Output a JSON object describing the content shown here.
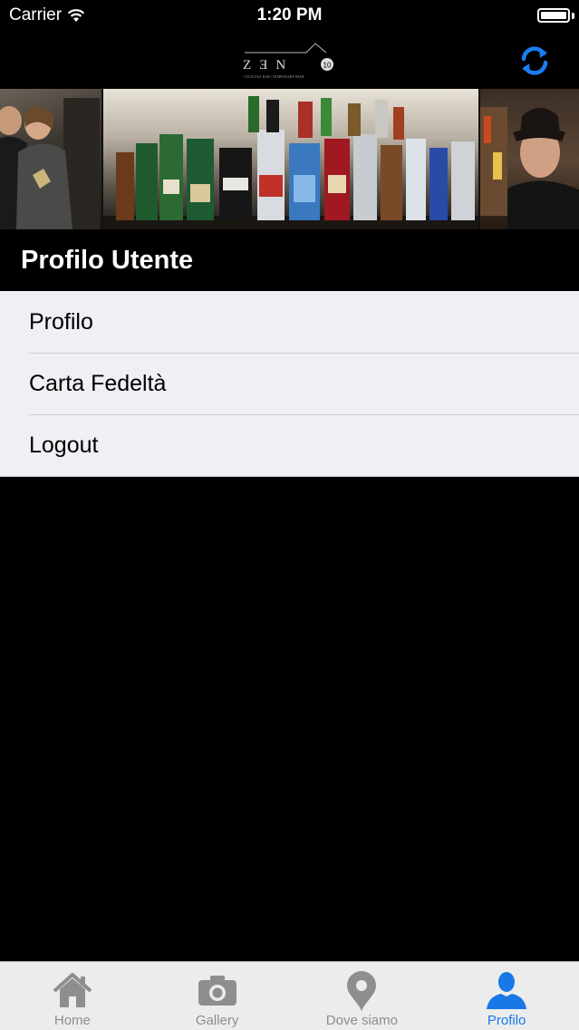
{
  "status_bar": {
    "carrier": "Carrier",
    "time": "1:20 PM"
  },
  "nav": {
    "logo_text": "Z Ǝ N",
    "logo_subtitle": "COCKTAIL BAR | TEMPORARY BIAR",
    "refresh_icon": "refresh-icon",
    "accent": "#1a7ef0"
  },
  "banner": {
    "images": [
      "people-photo",
      "bar-bottles-photo",
      "bartender-photo"
    ]
  },
  "section": {
    "title": "Profilo Utente"
  },
  "menu": {
    "items": [
      {
        "label": "Profilo"
      },
      {
        "label": "Carta Fedeltà"
      },
      {
        "label": "Logout"
      }
    ]
  },
  "tabs": [
    {
      "label": "Home",
      "icon": "home-icon",
      "active": false
    },
    {
      "label": "Gallery",
      "icon": "camera-icon",
      "active": false
    },
    {
      "label": "Dove siamo",
      "icon": "map-pin-icon",
      "active": false
    },
    {
      "label": "Profilo",
      "icon": "person-icon",
      "active": true
    }
  ],
  "colors": {
    "active_tab": "#1878e8",
    "inactive_tab": "#8e8e8e",
    "menu_bg": "#efeff4"
  }
}
